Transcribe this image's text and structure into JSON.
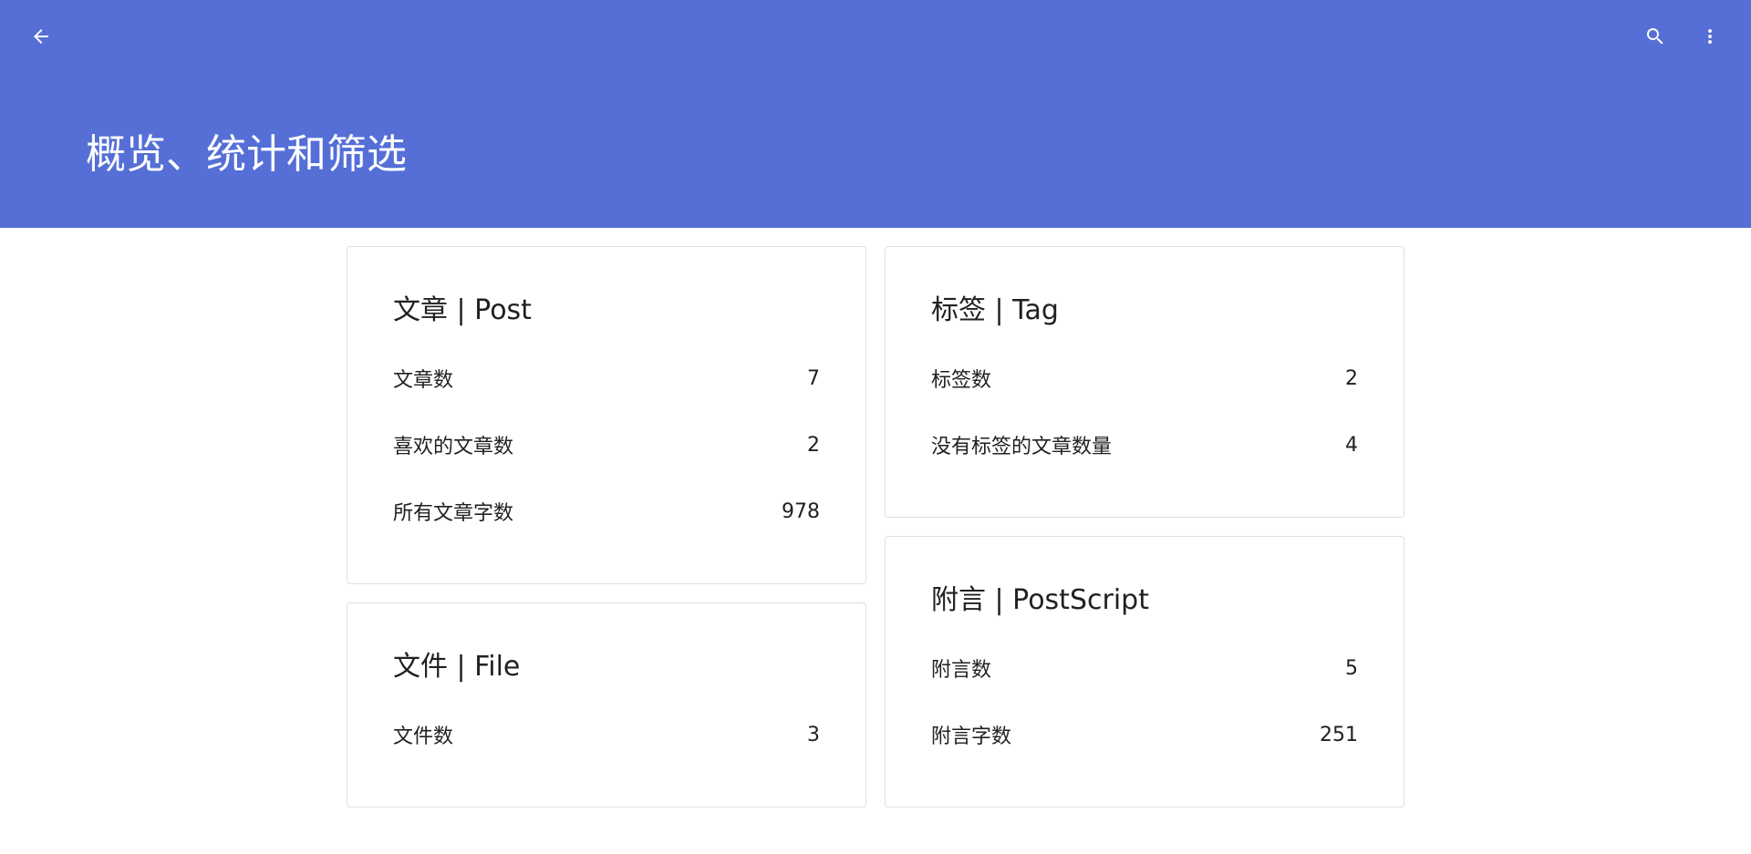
{
  "appbar": {
    "title": "概览、统计和筛选",
    "color": "#556fd7",
    "icons": {
      "back": "arrow-back-icon",
      "search": "search-icon",
      "more": "more-vert-icon"
    }
  },
  "cards": {
    "post": {
      "title": "文章 | Post",
      "rows": [
        {
          "label": "文章数",
          "value": "7"
        },
        {
          "label": "喜欢的文章数",
          "value": "2"
        },
        {
          "label": "所有文章字数",
          "value": "978"
        }
      ]
    },
    "file": {
      "title": "文件 | File",
      "rows": [
        {
          "label": "文件数",
          "value": "3"
        }
      ]
    },
    "tag": {
      "title": "标签 | Tag",
      "rows": [
        {
          "label": "标签数",
          "value": "2"
        },
        {
          "label": "没有标签的文章数量",
          "value": "4"
        }
      ]
    },
    "postscript": {
      "title": "附言 | PostScript",
      "rows": [
        {
          "label": "附言数",
          "value": "5"
        },
        {
          "label": "附言字数",
          "value": "251"
        }
      ]
    }
  }
}
